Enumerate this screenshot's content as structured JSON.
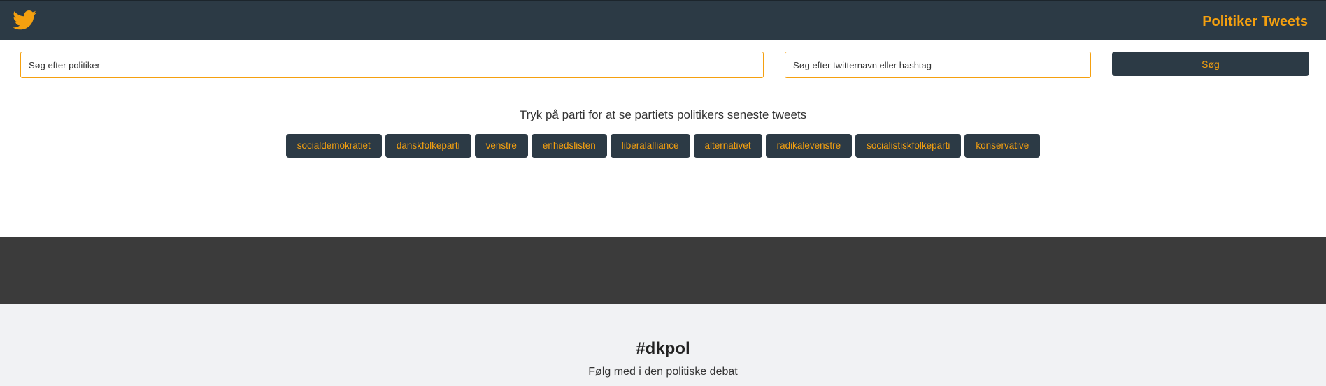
{
  "header": {
    "logo_icon": "twitter-bird-icon",
    "brand": "Politiker Tweets"
  },
  "search": {
    "politician_placeholder": "Søg efter politiker",
    "handle_placeholder": "Søg efter twitternavn eller hashtag",
    "button_label": "Søg"
  },
  "parties": {
    "prompt": "Tryk på parti for at se partiets politikers seneste tweets",
    "items": [
      {
        "label": "socialdemokratiet"
      },
      {
        "label": "danskfolkeparti"
      },
      {
        "label": "venstre"
      },
      {
        "label": "enhedslisten"
      },
      {
        "label": "liberalalliance"
      },
      {
        "label": "alternativet"
      },
      {
        "label": "radikalevenstre"
      },
      {
        "label": "socialistiskfolkeparti"
      },
      {
        "label": "konservative"
      }
    ]
  },
  "footer": {
    "hashtag": "#dkpol",
    "subtitle": "Følg med i den politiske debat"
  },
  "colors": {
    "navbar": "#2c3a45",
    "accent": "#f5a00f",
    "dark_band": "#3b3b3b",
    "footer_bg": "#f1f2f4"
  }
}
